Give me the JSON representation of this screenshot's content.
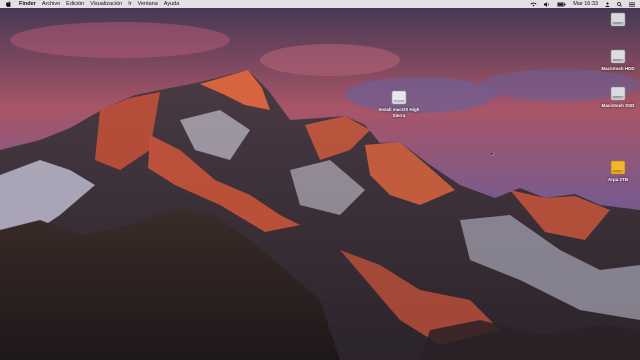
{
  "menubar": {
    "app_name": "Finder",
    "items": [
      "Archivo",
      "Edición",
      "Visualización",
      "Ir",
      "Ventana",
      "Ayuda"
    ],
    "clock": "Mar 16:33",
    "status_icons": [
      "wifi-icon",
      "volume-icon",
      "battery-icon",
      "user-icon",
      "search-icon",
      "list-icon"
    ]
  },
  "desktop": {
    "icons": [
      {
        "label": "Install macOS High Sierra",
        "icon": "installer-icon"
      },
      {
        "label": "",
        "icon": "external-disk-icon"
      },
      {
        "label": "Macintosh HDD",
        "icon": "hard-disk-icon"
      },
      {
        "label": "Macintosh SSD",
        "icon": "hard-disk-icon"
      },
      {
        "label": "Arpa 2TB",
        "icon": "external-disk-icon"
      }
    ]
  },
  "colors": {
    "menubar": "#f0eef2",
    "sky_glow": "#b75a6a",
    "peak_light": "#c9543a",
    "rock": "#3a3038",
    "snow": "#d8d6e4"
  }
}
